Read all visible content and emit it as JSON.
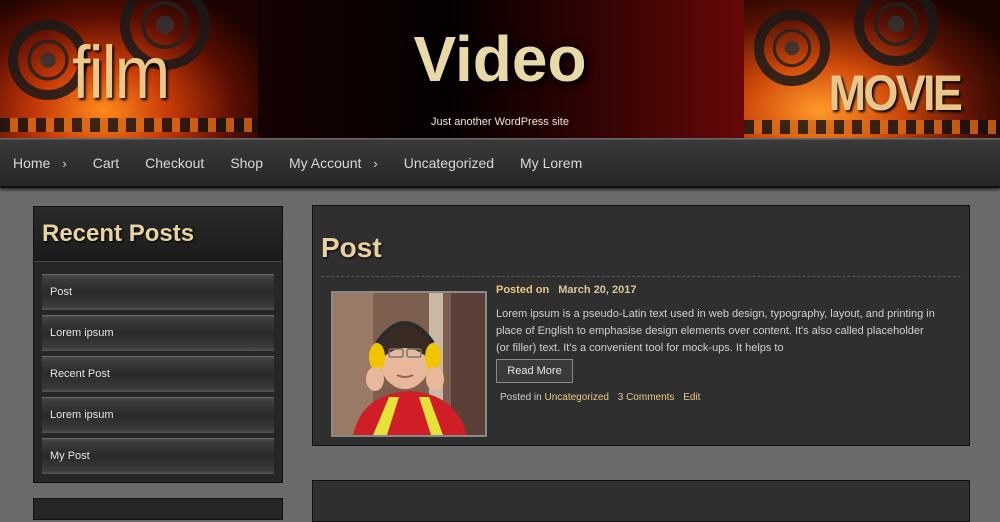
{
  "header": {
    "site_title": "Video",
    "site_description": "Just another WordPress site",
    "left_logo_text": "film",
    "right_logo_text": "MOVIE"
  },
  "nav": {
    "items": [
      {
        "label": "Home",
        "has_submenu": true
      },
      {
        "label": "Cart",
        "has_submenu": false
      },
      {
        "label": "Checkout",
        "has_submenu": false
      },
      {
        "label": "Shop",
        "has_submenu": false
      },
      {
        "label": "My Account",
        "has_submenu": true
      },
      {
        "label": "Uncategorized",
        "has_submenu": false
      },
      {
        "label": "My Lorem",
        "has_submenu": false
      }
    ],
    "submenu_arrow": "›"
  },
  "sidebar": {
    "title": "Recent Posts",
    "items": [
      {
        "label": "Post"
      },
      {
        "label": "Lorem ipsum"
      },
      {
        "label": "Recent Post"
      },
      {
        "label": "Lorem ipsum"
      },
      {
        "label": "My Post"
      }
    ]
  },
  "post": {
    "title": "Post",
    "posted_on_label": "Posted on",
    "date": "March 20, 2017",
    "excerpt": "Lorem ipsum is a pseudo-Latin text used in web design, typography, layout, and printing in place of English to emphasise design elements over content. It's also called placeholder (or filler) text. It's a convenient tool for mock-ups. It helps to",
    "read_more_label": "Read More",
    "posted_in_label": "Posted in",
    "category": "Uncategorized",
    "comments": "3 Comments",
    "edit_label": "Edit"
  },
  "colors": {
    "accent_gold": "#e7c985",
    "panel_dark": "#2f2f2f",
    "page_bg": "#6b6b6b"
  }
}
